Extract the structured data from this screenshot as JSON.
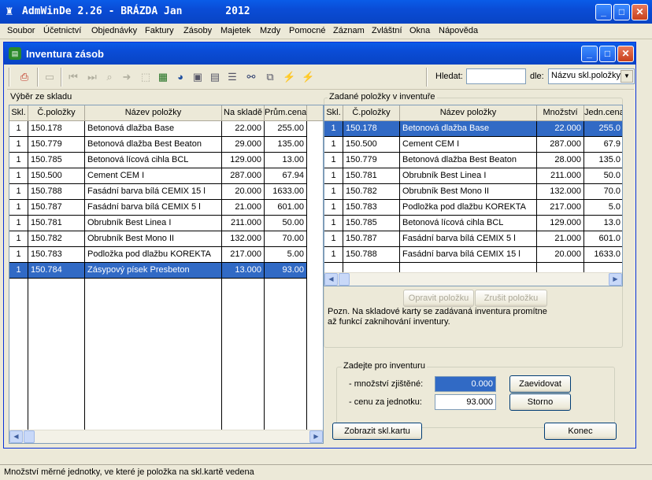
{
  "app": {
    "title_left": "AdmWinDe 2.26 - BRÁZDA Jan",
    "title_year": "2012"
  },
  "menu": [
    "Soubor",
    "Účetnictví",
    "Objednávky",
    "Faktury",
    "Zásoby",
    "Majetek",
    "Mzdy",
    "Pomocné",
    "Záznam",
    "Zvláštní",
    "Okna",
    "Nápověda"
  ],
  "window": {
    "title": "Inventura zásob"
  },
  "search": {
    "label": "Hledat:",
    "value": "",
    "by_label": "dle:",
    "by_value": "Názvu skl.položky"
  },
  "left": {
    "group_label": "Výběr ze skladu",
    "columns": [
      "Skl.",
      "Č.položky",
      "Název položky",
      "Na skladě",
      "Prům.cena"
    ],
    "rows": [
      [
        "1",
        "150.178",
        "Betonová dlažba Base",
        "22.000",
        "255.00"
      ],
      [
        "1",
        "150.779",
        "Betonová dlažba Best Beaton",
        "29.000",
        "135.00"
      ],
      [
        "1",
        "150.785",
        "Betonová lícová cihla BCL",
        "129.000",
        "13.00"
      ],
      [
        "1",
        "150.500",
        "Cement CEM I",
        "287.000",
        "67.94"
      ],
      [
        "1",
        "150.788",
        "Fasádní barva bílá CEMIX 15 l",
        "20.000",
        "1633.00"
      ],
      [
        "1",
        "150.787",
        "Fasádní barva bílá CEMIX 5 l",
        "21.000",
        "601.00"
      ],
      [
        "1",
        "150.781",
        "Obrubník Best Linea I",
        "211.000",
        "50.00"
      ],
      [
        "1",
        "150.782",
        "Obrubník Best Mono II",
        "132.000",
        "70.00"
      ],
      [
        "1",
        "150.783",
        "Podložka pod dlažbu KOREKTA",
        "217.000",
        "5.00"
      ],
      [
        "1",
        "150.784",
        "Zásypový písek Presbeton",
        "13.000",
        "93.00"
      ]
    ],
    "selected_row": 9
  },
  "right": {
    "group_label": "Zadané položky v inventuře",
    "columns": [
      "Skl.",
      "Č.položky",
      "Název položky",
      "Množství",
      "Jedn.cena"
    ],
    "rows": [
      [
        "1",
        "150.178",
        "Betonová dlažba Base",
        "22.000",
        "255.0"
      ],
      [
        "1",
        "150.500",
        "Cement CEM I",
        "287.000",
        "67.9"
      ],
      [
        "1",
        "150.779",
        "Betonová dlažba Best Beaton",
        "28.000",
        "135.0"
      ],
      [
        "1",
        "150.781",
        "Obrubník Best Linea I",
        "211.000",
        "50.0"
      ],
      [
        "1",
        "150.782",
        "Obrubník Best Mono II",
        "132.000",
        "70.0"
      ],
      [
        "1",
        "150.783",
        "Podložka pod dlažbu KOREKTA",
        "217.000",
        "5.0"
      ],
      [
        "1",
        "150.785",
        "Betonová lícová cihla BCL",
        "129.000",
        "13.0"
      ],
      [
        "1",
        "150.787",
        "Fasádní barva bílá CEMIX 5 l",
        "21.000",
        "601.0"
      ],
      [
        "1",
        "150.788",
        "Fasádní barva bílá CEMIX 15 l",
        "20.000",
        "1633.0"
      ]
    ],
    "selected_row": 0,
    "edit_button": "Opravit položku",
    "cancel_item_button": "Zrušit položku",
    "note": "Pozn. Na skladové karty se zadávaná inventura promítne\naž funkcí zaknihování inventury."
  },
  "entry": {
    "group_label": "Zadejte pro inventuru",
    "qty_label": "- množství zjištěné:",
    "qty_value": "0.000",
    "price_label": "- cenu za jednotku:",
    "price_value": "93.000",
    "record_button": "Zaevidovat",
    "storno_button": "Storno"
  },
  "buttons": {
    "show_card": "Zobrazit skl.kartu",
    "end": "Konec"
  },
  "status": "Množství měrné jednotky, ve které je položka na skl.kartě vedena",
  "colors": {
    "titlebar": "#0a4cd6",
    "selection": "#316ac5",
    "face": "#ece9d8"
  }
}
